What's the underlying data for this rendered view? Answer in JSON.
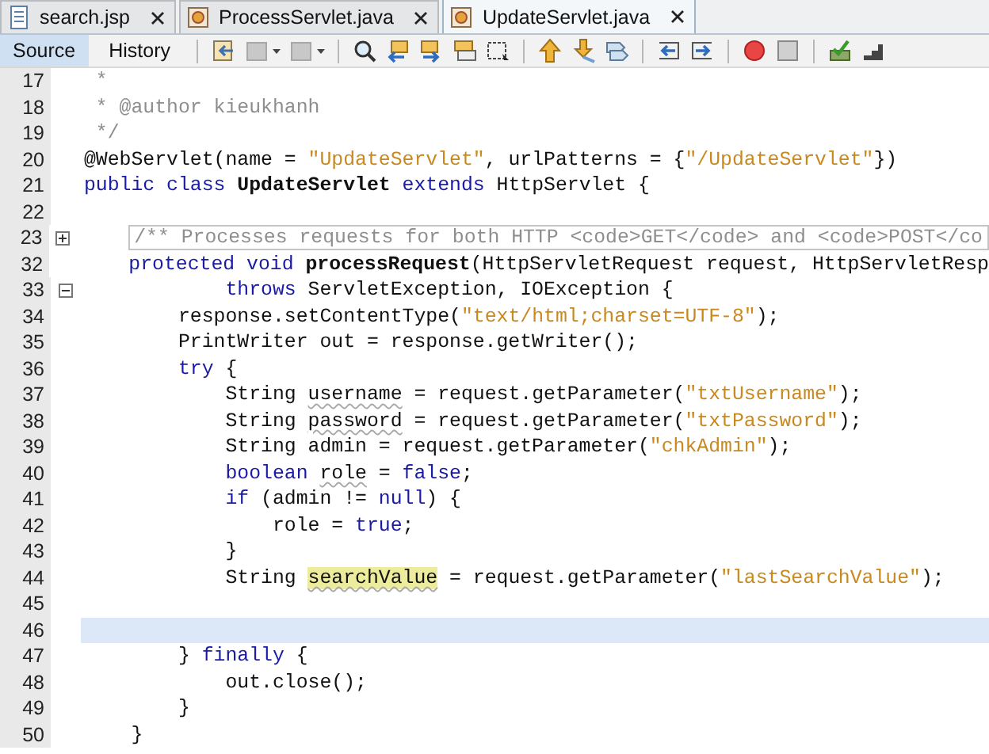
{
  "tabs": [
    {
      "label": "search.jsp",
      "kind": "jsp",
      "selected": false
    },
    {
      "label": "ProcessServlet.java",
      "kind": "java",
      "selected": false
    },
    {
      "label": "UpdateServlet.java",
      "kind": "java",
      "selected": true
    }
  ],
  "view_tabs": [
    {
      "label": "Source",
      "selected": true
    },
    {
      "label": "History",
      "selected": false
    }
  ],
  "lines": [
    {
      "number": "17",
      "current": false,
      "tokens": [
        {
          "t": " *",
          "kind": "comment"
        }
      ]
    },
    {
      "number": "18",
      "current": false,
      "tokens": [
        {
          "t": " * @author kieukhanh",
          "kind": "comment"
        }
      ]
    },
    {
      "number": "19",
      "current": false,
      "tokens": [
        {
          "t": " */",
          "kind": "comment"
        }
      ]
    },
    {
      "number": "20",
      "current": false,
      "tokens": [
        {
          "t": "@WebServlet(name = ",
          "kind": "plain"
        },
        {
          "t": "\"UpdateServlet\"",
          "kind": "string"
        },
        {
          "t": ", urlPatterns = {",
          "kind": "plain"
        },
        {
          "t": "\"/UpdateServlet\"",
          "kind": "string"
        },
        {
          "t": "})",
          "kind": "plain"
        }
      ]
    },
    {
      "number": "21",
      "current": false,
      "tokens": [
        {
          "t": "public class ",
          "kind": "keyword"
        },
        {
          "t": "UpdateServlet",
          "kind": "bold"
        },
        {
          "t": " extends ",
          "kind": "keyword"
        },
        {
          "t": "HttpServlet {",
          "kind": "plain"
        }
      ]
    },
    {
      "number": "22",
      "current": false
    },
    {
      "number": "23",
      "current": false,
      "kind": "fold_collapsed",
      "tokens": [
        {
          "t": "    /** Processes requests for both HTTP <code>GET</code> and <code>POST</co",
          "kind": "folded"
        }
      ]
    },
    {
      "number": "32",
      "current": false,
      "tokens": [
        {
          "t": "    protected void ",
          "kind": "keyword"
        },
        {
          "t": "processRequest",
          "kind": "bold"
        },
        {
          "t": "(HttpServletRequest request, HttpServletResp",
          "kind": "plain"
        }
      ]
    },
    {
      "number": "33",
      "current": false,
      "kind": "fold_expanded",
      "tokens": [
        {
          "t": "            throws ",
          "kind": "keyword"
        },
        {
          "t": "ServletException, IOException {",
          "kind": "plain"
        }
      ]
    },
    {
      "number": "34",
      "current": false,
      "tokens": [
        {
          "t": "        response.setContentType(",
          "kind": "plain"
        },
        {
          "t": "\"text/html;charset=UTF-8\"",
          "kind": "string"
        },
        {
          "t": ");",
          "kind": "plain"
        }
      ]
    },
    {
      "number": "35",
      "current": false,
      "tokens": [
        {
          "t": "        PrintWriter out = response.getWriter();",
          "kind": "plain"
        }
      ]
    },
    {
      "number": "36",
      "current": false,
      "tokens": [
        {
          "t": "        try",
          "kind": "keyword"
        },
        {
          "t": " {",
          "kind": "plain"
        }
      ]
    },
    {
      "number": "37",
      "current": false,
      "tokens": [
        {
          "t": "            String ",
          "kind": "plain"
        },
        {
          "t": "username",
          "kind": "warning"
        },
        {
          "t": " = request.getParameter(",
          "kind": "plain"
        },
        {
          "t": "\"txtUsername\"",
          "kind": "string"
        },
        {
          "t": ");",
          "kind": "plain"
        }
      ]
    },
    {
      "number": "38",
      "current": false,
      "tokens": [
        {
          "t": "            String ",
          "kind": "plain"
        },
        {
          "t": "password",
          "kind": "warning"
        },
        {
          "t": " = request.getParameter(",
          "kind": "plain"
        },
        {
          "t": "\"txtPassword\"",
          "kind": "string"
        },
        {
          "t": ");",
          "kind": "plain"
        }
      ]
    },
    {
      "number": "39",
      "current": false,
      "tokens": [
        {
          "t": "            String admin = request.getParameter(",
          "kind": "plain"
        },
        {
          "t": "\"chkAdmin\"",
          "kind": "string"
        },
        {
          "t": ");",
          "kind": "plain"
        }
      ]
    },
    {
      "number": "40",
      "current": false,
      "tokens": [
        {
          "t": "            boolean ",
          "kind": "keyword"
        },
        {
          "t": "role",
          "kind": "warning"
        },
        {
          "t": " = ",
          "kind": "plain"
        },
        {
          "t": "false",
          "kind": "keyword"
        },
        {
          "t": ";",
          "kind": "plain"
        }
      ]
    },
    {
      "number": "41",
      "current": false,
      "tokens": [
        {
          "t": "            if",
          "kind": "keyword"
        },
        {
          "t": " (admin != ",
          "kind": "plain"
        },
        {
          "t": "null",
          "kind": "keyword"
        },
        {
          "t": ") {",
          "kind": "plain"
        }
      ]
    },
    {
      "number": "42",
      "current": false,
      "tokens": [
        {
          "t": "                role = ",
          "kind": "plain"
        },
        {
          "t": "true",
          "kind": "keyword"
        },
        {
          "t": ";",
          "kind": "plain"
        }
      ]
    },
    {
      "number": "43",
      "current": false,
      "tokens": [
        {
          "t": "            }",
          "kind": "plain"
        }
      ]
    },
    {
      "number": "44",
      "current": false,
      "tokens": [
        {
          "t": "            String ",
          "kind": "plain"
        },
        {
          "t": "searchValue",
          "kind": "marked"
        },
        {
          "t": " = request.getParameter(",
          "kind": "plain"
        },
        {
          "t": "\"lastSearchValue\"",
          "kind": "string"
        },
        {
          "t": ");",
          "kind": "plain"
        }
      ]
    },
    {
      "number": "45",
      "current": false
    },
    {
      "number": "46",
      "current": true
    },
    {
      "number": "47",
      "current": false,
      "tokens": [
        {
          "t": "        } ",
          "kind": "plain"
        },
        {
          "t": "finally",
          "kind": "keyword"
        },
        {
          "t": " {",
          "kind": "plain"
        }
      ]
    },
    {
      "number": "48",
      "current": false,
      "tokens": [
        {
          "t": "            out.close();",
          "kind": "plain"
        }
      ]
    },
    {
      "number": "49",
      "current": false,
      "tokens": [
        {
          "t": "        }",
          "kind": "plain"
        }
      ]
    },
    {
      "number": "50",
      "current": false,
      "tokens": [
        {
          "t": "    }",
          "kind": "plain"
        }
      ]
    }
  ]
}
